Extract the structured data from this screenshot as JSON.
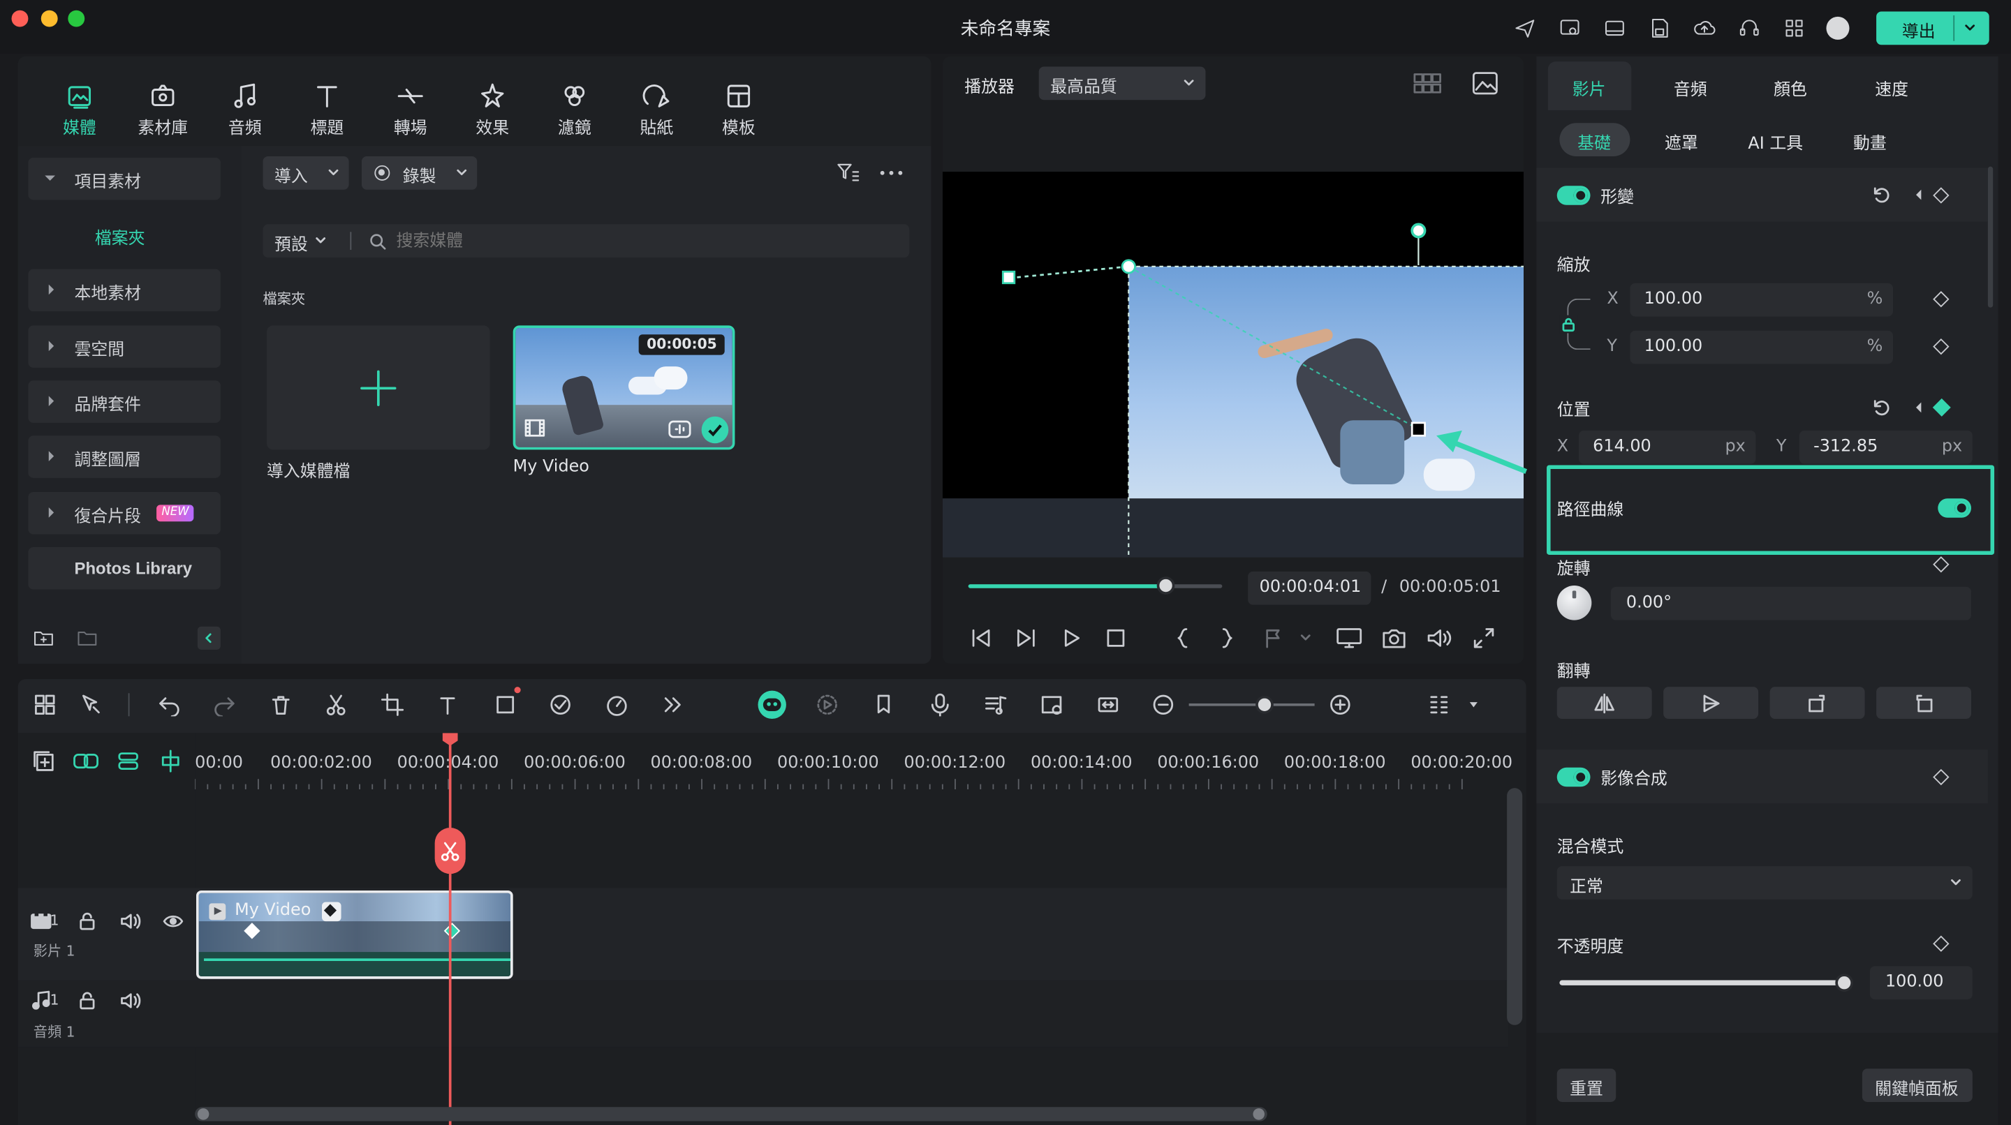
{
  "window": {
    "title": "未命名專案",
    "export_label": "導出"
  },
  "colors": {
    "accent": "#35d6b0",
    "playhead": "#ee5a5a",
    "background": "#1a1b1e",
    "panel": "#222428"
  },
  "toolbar": {
    "items": [
      {
        "label": "媒體",
        "icon": "media-icon",
        "active": true
      },
      {
        "label": "素材庫",
        "icon": "stock-icon"
      },
      {
        "label": "音頻",
        "icon": "audio-icon"
      },
      {
        "label": "標題",
        "icon": "title-icon"
      },
      {
        "label": "轉場",
        "icon": "transition-icon"
      },
      {
        "label": "效果",
        "icon": "effects-icon"
      },
      {
        "label": "濾鏡",
        "icon": "filters-icon"
      },
      {
        "label": "貼紙",
        "icon": "stickers-icon"
      },
      {
        "label": "模板",
        "icon": "templates-icon"
      }
    ]
  },
  "sidebar": {
    "project": "項目素材",
    "folder": "檔案夾",
    "items": [
      "本地素材",
      "雲空間",
      "品牌套件",
      "調整圖層",
      "復合片段"
    ],
    "new_badge": "NEW",
    "photos": "Photos Library"
  },
  "media": {
    "import_label": "導入",
    "record_label": "錄製",
    "preset_label": "預設",
    "search_placeholder": "搜索媒體",
    "folder_label": "檔案夾",
    "import_tile_label": "導入媒體檔",
    "clip": {
      "name": "My Video",
      "duration": "00:00:05"
    }
  },
  "player": {
    "label": "播放器",
    "quality": "最高品質",
    "current_time": "00:00:04:01",
    "separator": "/",
    "total_time": "00:00:05:01",
    "progress": 0.78
  },
  "inspector": {
    "tabs": [
      "影片",
      "音頻",
      "顏色",
      "速度"
    ],
    "subtabs": [
      "基礎",
      "遮罩",
      "AI 工具",
      "動畫"
    ],
    "transform": {
      "label": "形變",
      "enabled": true
    },
    "scale": {
      "label": "縮放",
      "x_label": "X",
      "x": "100.00",
      "y_label": "Y",
      "y": "100.00",
      "unit": "%"
    },
    "position": {
      "label": "位置",
      "x_label": "X",
      "x": "614.00",
      "y_label": "Y",
      "y": "-312.85",
      "unit": "px"
    },
    "path_curve": {
      "label": "路徑曲線",
      "enabled": true
    },
    "rotation": {
      "label": "旋轉",
      "value": "0.00°"
    },
    "flip": {
      "label": "翻轉"
    },
    "compositing": {
      "label": "影像合成",
      "enabled": true
    },
    "blend_mode": {
      "label": "混合模式",
      "value": "正常"
    },
    "opacity": {
      "label": "不透明度",
      "value": "100.00",
      "level": 1.0
    },
    "reset_label": "重置",
    "keyframe_panel_label": "關鍵幀面板"
  },
  "timeline": {
    "ruler": [
      "00:00",
      "00:00:02:00",
      "00:00:04:00",
      "00:00:06:00",
      "00:00:08:00",
      "00:00:10:00",
      "00:00:12:00",
      "00:00:14:00",
      "00:00:16:00",
      "00:00:18:00",
      "00:00:20:00"
    ],
    "video_track": {
      "index": "1",
      "name": "影片 1"
    },
    "audio_track": {
      "index": "1",
      "name": "音頻 1"
    },
    "clip_name": "My Video",
    "zoom_level": 0.6
  }
}
